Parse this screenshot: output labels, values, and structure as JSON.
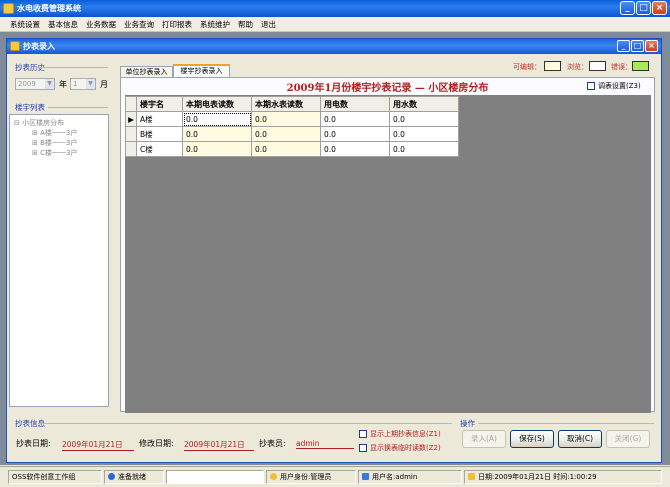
{
  "app": {
    "title": "水电收费管理系统"
  },
  "menu": [
    "系统设置",
    "基本信息",
    "业务数据",
    "业务查询",
    "打印报表",
    "系统维护",
    "帮助",
    "退出"
  ],
  "window": {
    "title": "抄表录入"
  },
  "history": {
    "label": "抄表历史",
    "year": "2009",
    "year_unit": "年",
    "month": "1",
    "month_unit": "月"
  },
  "tree": {
    "label": "楼宇列表",
    "root": "小区楼房分布",
    "nodes": [
      "A楼一一3户",
      "B楼一一3户",
      "C楼一一3户"
    ]
  },
  "tabs": [
    "单位抄表录入",
    "楼宇抄表录入"
  ],
  "legend": {
    "editable": "可编辑：",
    "browse": "浏览：",
    "error": "错误：",
    "editable_color": "#fffbe0",
    "browse_color": "#ffffff",
    "error_color": "#a8e860"
  },
  "adjust": {
    "label": "调表设置(Z3)"
  },
  "grid": {
    "title": "2009年1月份楼宇抄表记录 — 小区楼房分布",
    "columns": [
      "楼宇名",
      "本期电表读数",
      "本期水表读数",
      "用电数",
      "用水数"
    ],
    "rows": [
      [
        "A楼",
        "0.0",
        "0.0",
        "0.0",
        "0.0"
      ],
      [
        "B楼",
        "0.0",
        "0.0",
        "0.0",
        "0.0"
      ],
      [
        "C楼",
        "0.0",
        "0.0",
        "0.0",
        "0.0"
      ]
    ]
  },
  "info": {
    "label": "抄表信息",
    "read_date_label": "抄表日期:",
    "read_date": "2009年01月21日",
    "mod_date_label": "修改日期:",
    "mod_date": "2009年01月21日",
    "reader_label": "抄表员:",
    "reader": "admin",
    "chk1": "显示上期抄表信息(Z1)",
    "chk2": "显示换表临时读数(Z2)"
  },
  "ops": {
    "label": "操作",
    "enter": "录入(A)",
    "save": "保存(S)",
    "cancel": "取消(C)",
    "close": "关闭(G)"
  },
  "status": {
    "company": "OSS软件创意工作组",
    "ready": "准备就绪",
    "role": "用户身份:管理员",
    "user": "用户名:admin",
    "datetime": "日期:2009年01月21日   时间:1:00:29"
  }
}
